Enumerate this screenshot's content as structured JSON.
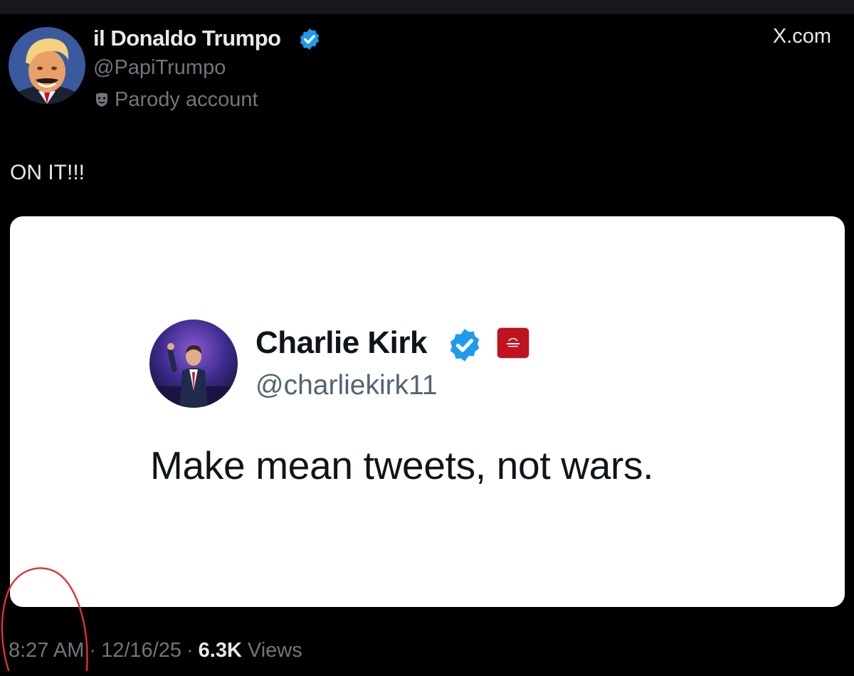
{
  "post": {
    "author": {
      "display_name": "il Donaldo Trumpo",
      "handle": "@PapiTrumpo",
      "label": "Parody account",
      "verified": true
    },
    "site": "X.com",
    "text": "ON IT!!!",
    "meta": {
      "time": "8:27 AM",
      "date": "12/16/25",
      "views_count": "6.3K",
      "views_label": "Views",
      "separator": "·"
    }
  },
  "quoted_image": {
    "display_name": "Charlie Kirk",
    "handle": "@charliekirk11",
    "text": "Make mean tweets, not wars.",
    "verified": true,
    "affiliate_badge": "org-badge"
  },
  "annotation": {
    "shape": "red-circle-marker",
    "color": "#e0303c"
  },
  "colors": {
    "background": "#000000",
    "text_primary": "#e7e9ea",
    "text_secondary": "#71767b",
    "verified_blue": "#1d9bf0",
    "card_background": "#ffffff"
  }
}
